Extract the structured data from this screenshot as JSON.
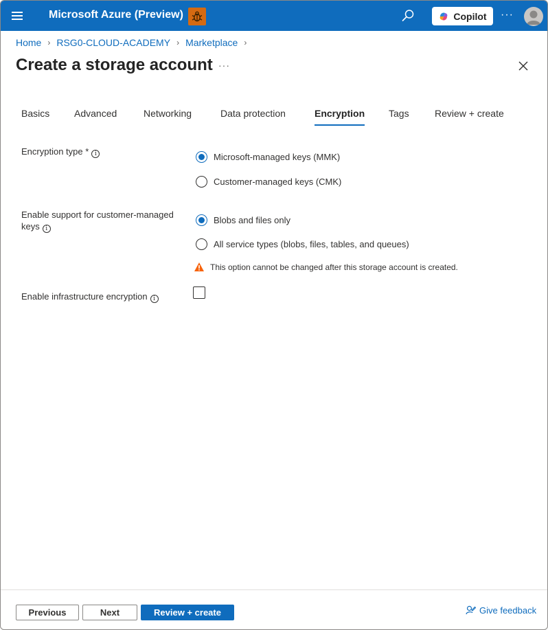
{
  "header": {
    "app_title": "Microsoft Azure (Preview)",
    "copilot_label": "Copilot",
    "more_label": "···"
  },
  "breadcrumb": {
    "items": [
      "Home",
      "RSG0-CLOUD-ACADEMY",
      "Marketplace"
    ]
  },
  "page": {
    "title": "Create a storage account",
    "more_label": "···"
  },
  "tabs": [
    {
      "label": "Basics",
      "active": false
    },
    {
      "label": "Advanced",
      "active": false
    },
    {
      "label": "Networking",
      "active": false
    },
    {
      "label": "Data protection",
      "active": false
    },
    {
      "label": "Encryption",
      "active": true
    },
    {
      "label": "Tags",
      "active": false
    },
    {
      "label": "Review + create",
      "active": false
    }
  ],
  "form": {
    "encryption_type": {
      "label": "Encryption type *",
      "options": [
        {
          "label": "Microsoft-managed keys (MMK)",
          "checked": true
        },
        {
          "label": "Customer-managed keys (CMK)",
          "checked": false
        }
      ]
    },
    "cmk_support": {
      "label_line1": "Enable support for customer-managed",
      "label_line2": "keys",
      "options": [
        {
          "label": "Blobs and files only",
          "checked": true
        },
        {
          "label": "All service types (blobs, files, tables, and queues)",
          "checked": false
        }
      ],
      "warning": "This option cannot be changed after this storage account is created."
    },
    "infrastructure_encryption": {
      "label": "Enable infrastructure encryption",
      "checked": false
    }
  },
  "footer": {
    "previous_label": "Previous",
    "next_label": "Next",
    "review_label": "Review + create",
    "feedback_label": "Give feedback"
  },
  "colors": {
    "accent": "#0f6cbd",
    "warning": "#f7630c",
    "bug_badge": "#d46a12"
  }
}
